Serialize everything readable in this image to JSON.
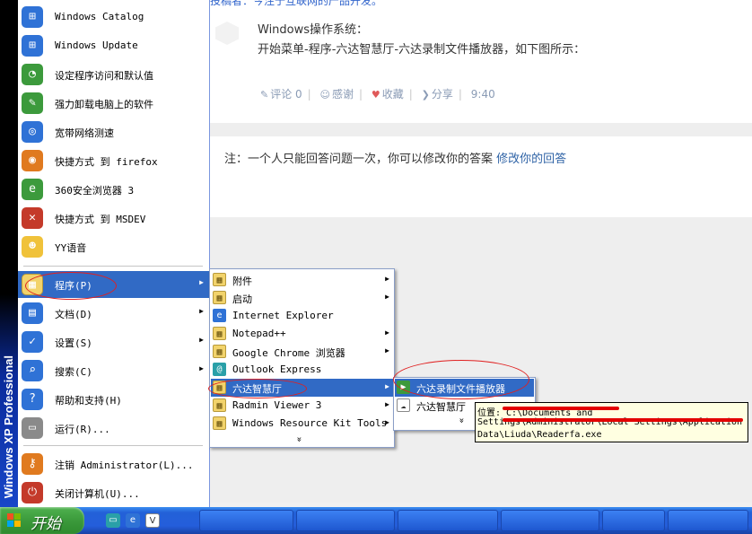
{
  "webpage": {
    "top_text": "投稿者：今注于互联网的产品开发。",
    "answer_title": "Windows操作系统：",
    "answer_body": "开始菜单-程序-六达智慧厅-六达录制文件播放器，如下图所示：",
    "actions": {
      "comment": "评论 0",
      "thanks": "感谢",
      "favorite": "收藏",
      "share": "分享",
      "time": "9:40"
    },
    "note_text": "注：一个人只能回答问题一次，你可以修改你的答案",
    "note_link": "修改你的回答"
  },
  "start_menu": {
    "banner_text": "Windows XP Professional",
    "pinned": [
      {
        "label": "Windows Catalog",
        "icon": "windows-catalog-icon",
        "glyph": "⊞"
      },
      {
        "label": "Windows Update",
        "icon": "windows-update-icon",
        "glyph": "⊞"
      },
      {
        "label": "设定程序访问和默认值",
        "icon": "program-defaults-icon",
        "glyph": "◔"
      },
      {
        "label": "强力卸载电脑上的软件",
        "icon": "uninstall-icon",
        "glyph": "✎"
      },
      {
        "label": "宽带网络测速",
        "icon": "network-speed-icon",
        "glyph": "◎"
      },
      {
        "label": "快捷方式 到 firefox",
        "icon": "firefox-icon",
        "glyph": "◉"
      },
      {
        "label": "360安全浏览器 3",
        "icon": "360-browser-icon",
        "glyph": "e"
      },
      {
        "label": "快捷方式 到 MSDEV",
        "icon": "msdev-icon",
        "glyph": "✕"
      },
      {
        "label": "YY语音",
        "icon": "yy-voice-icon",
        "glyph": "☻"
      }
    ],
    "system": [
      {
        "label": "程序(P)",
        "icon": "programs-icon",
        "glyph": "▦",
        "arrow": true
      },
      {
        "label": "文档(D)",
        "icon": "documents-icon",
        "glyph": "▤",
        "arrow": true
      },
      {
        "label": "设置(S)",
        "icon": "settings-icon",
        "glyph": "✓",
        "arrow": true
      },
      {
        "label": "搜索(C)",
        "icon": "search-icon",
        "glyph": "⌕",
        "arrow": true
      },
      {
        "label": "帮助和支持(H)",
        "icon": "help-icon",
        "glyph": "?",
        "arrow": false
      },
      {
        "label": "运行(R)...",
        "icon": "run-icon",
        "glyph": "▭",
        "arrow": false
      }
    ],
    "bottom": [
      {
        "label": "注销 Administrator(L)...",
        "icon": "logoff-icon",
        "glyph": "⚷"
      },
      {
        "label": "关闭计算机(U)...",
        "icon": "shutdown-icon",
        "glyph": "⏻"
      }
    ]
  },
  "programs_menu": {
    "items": [
      {
        "label": "附件",
        "icon": "folder-icon",
        "arrow": true
      },
      {
        "label": "启动",
        "icon": "folder-icon",
        "arrow": true
      },
      {
        "label": "Internet Explorer",
        "icon": "internet-explorer-icon",
        "arrow": false
      },
      {
        "label": "Notepad++",
        "icon": "folder-icon",
        "arrow": true
      },
      {
        "label": "Google Chrome 浏览器",
        "icon": "folder-icon",
        "arrow": true
      },
      {
        "label": "Outlook Express",
        "icon": "outlook-express-icon",
        "arrow": false
      },
      {
        "label": "六达智慧厅",
        "icon": "folder-icon",
        "arrow": true
      },
      {
        "label": "Radmin Viewer 3",
        "icon": "folder-icon",
        "arrow": true
      },
      {
        "label": "Windows Resource Kit Tools",
        "icon": "folder-icon",
        "arrow": true
      }
    ],
    "more": "»"
  },
  "liuda_menu": {
    "items": [
      {
        "label": "六达录制文件播放器",
        "icon": "player-icon"
      },
      {
        "label": "六达智慧厅",
        "icon": "liuda-app-icon"
      }
    ],
    "more": "»"
  },
  "tooltip": {
    "lines": [
      "位置: C:\\Documents and",
      "Settings\\Administrator\\Local Settings\\Application",
      "Data\\Liuda\\Readerfa.exe"
    ]
  },
  "taskbar": {
    "start_label": "开始",
    "quick_launch": [
      "desktop-icon",
      "ie-icon",
      "vs-icon"
    ]
  },
  "colors": {
    "highlight": "#316ac5",
    "taskbar_blue": "#245edb",
    "start_green": "#3b9a3b",
    "annotation_red": "#e02020"
  }
}
